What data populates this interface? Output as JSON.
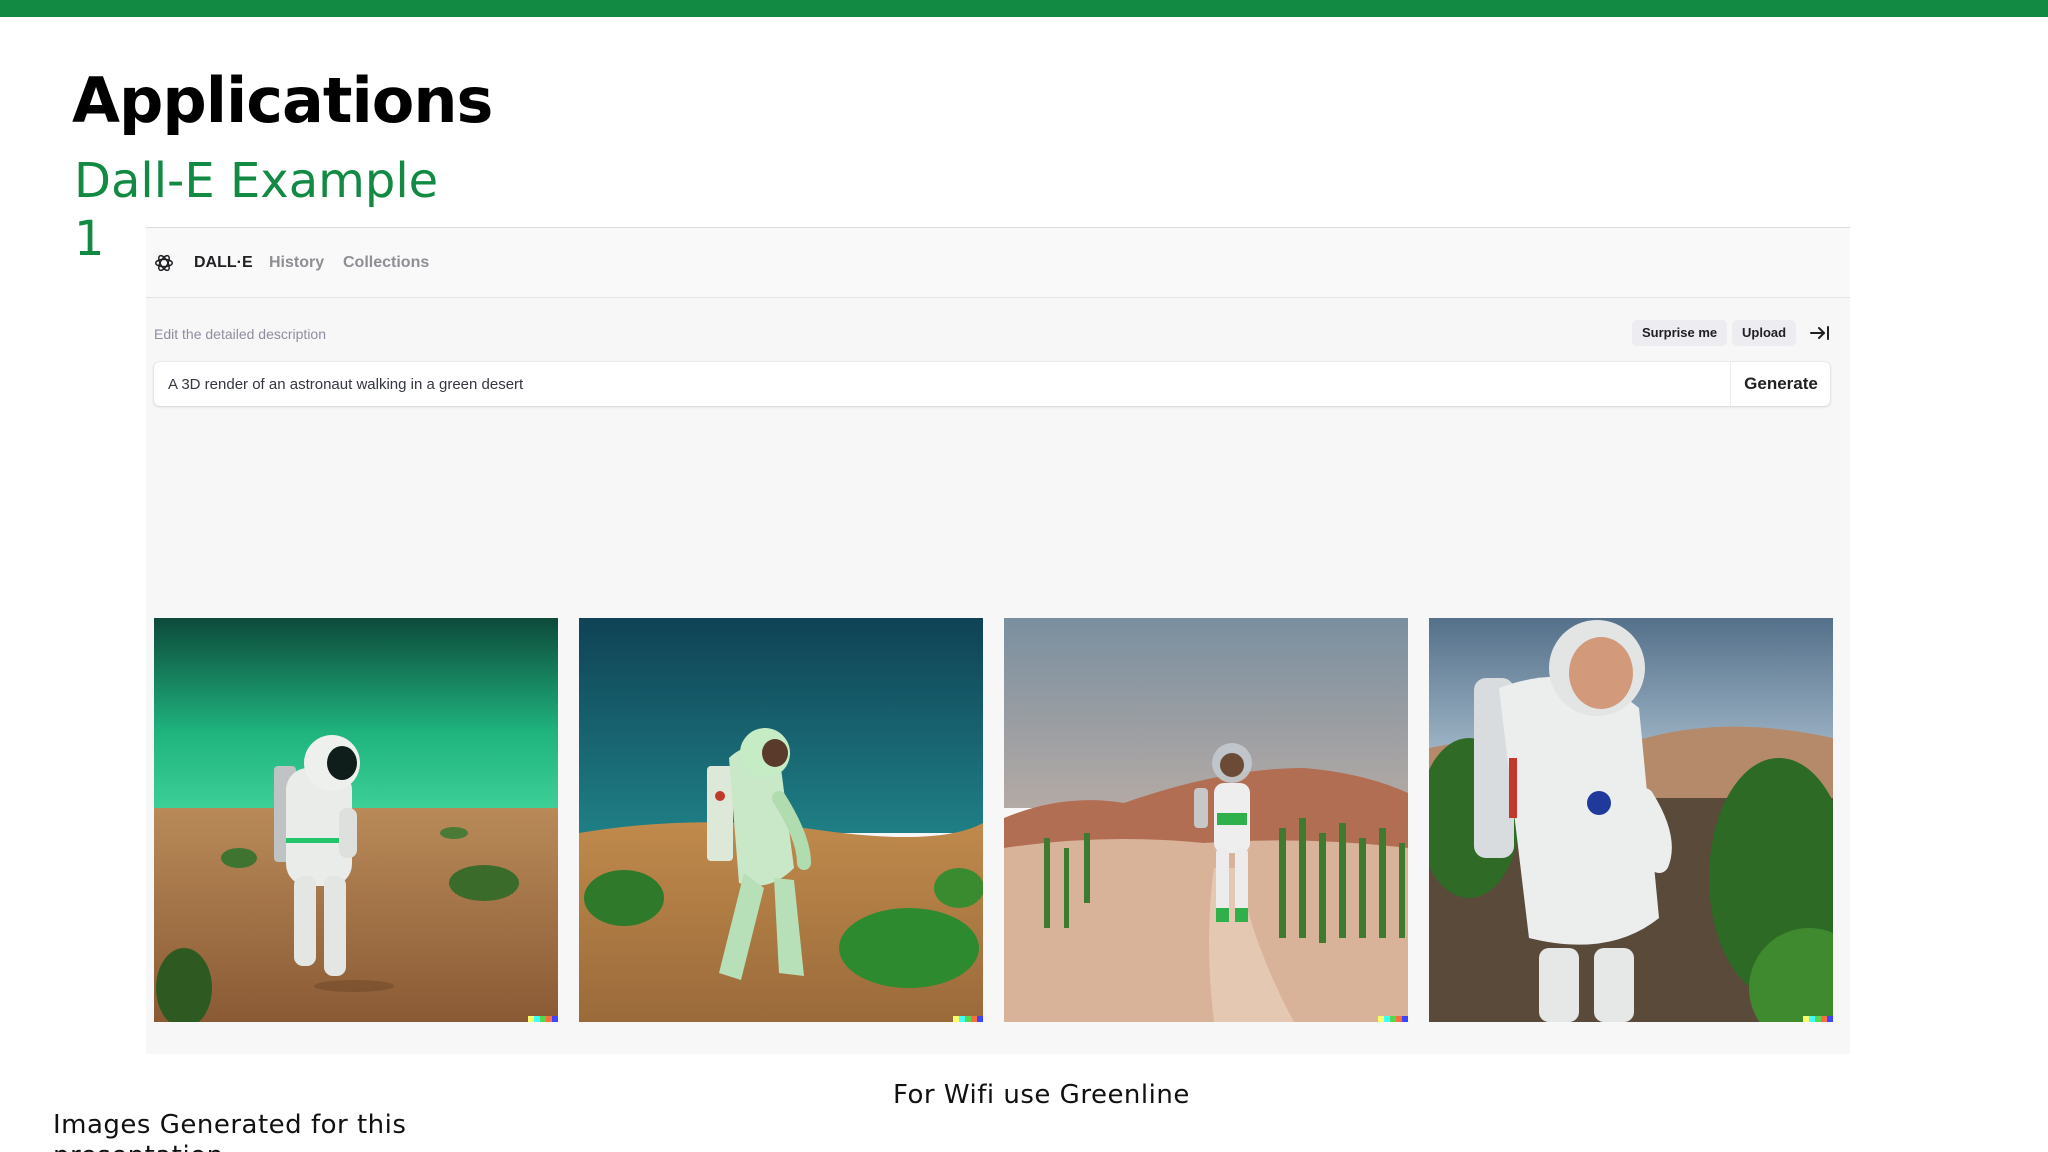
{
  "slide": {
    "title": "Applications",
    "subtitle": "Dall-E Example 1",
    "accent_color": "#128a43",
    "footer_left": "Images Generated for this presentation",
    "footer_mid": "For Wifi use Greenline"
  },
  "dalle": {
    "nav": {
      "logo_icon": "openai-logo-icon",
      "brand": "DALL·E",
      "history": "History",
      "collections": "Collections"
    },
    "edit_label": "Edit the detailed description",
    "surprise_label": "Surprise me",
    "upload_label": "Upload",
    "collapse_icon": "arrow-to-right-icon",
    "prompt_value": "A 3D render of an astronaut walking in a green desert",
    "generate_label": "Generate",
    "images": [
      {
        "name": "astronaut-green-sky"
      },
      {
        "name": "astronaut-teal-sky"
      },
      {
        "name": "astronaut-tall-grass"
      },
      {
        "name": "astronaut-closeup-bushes"
      }
    ]
  }
}
